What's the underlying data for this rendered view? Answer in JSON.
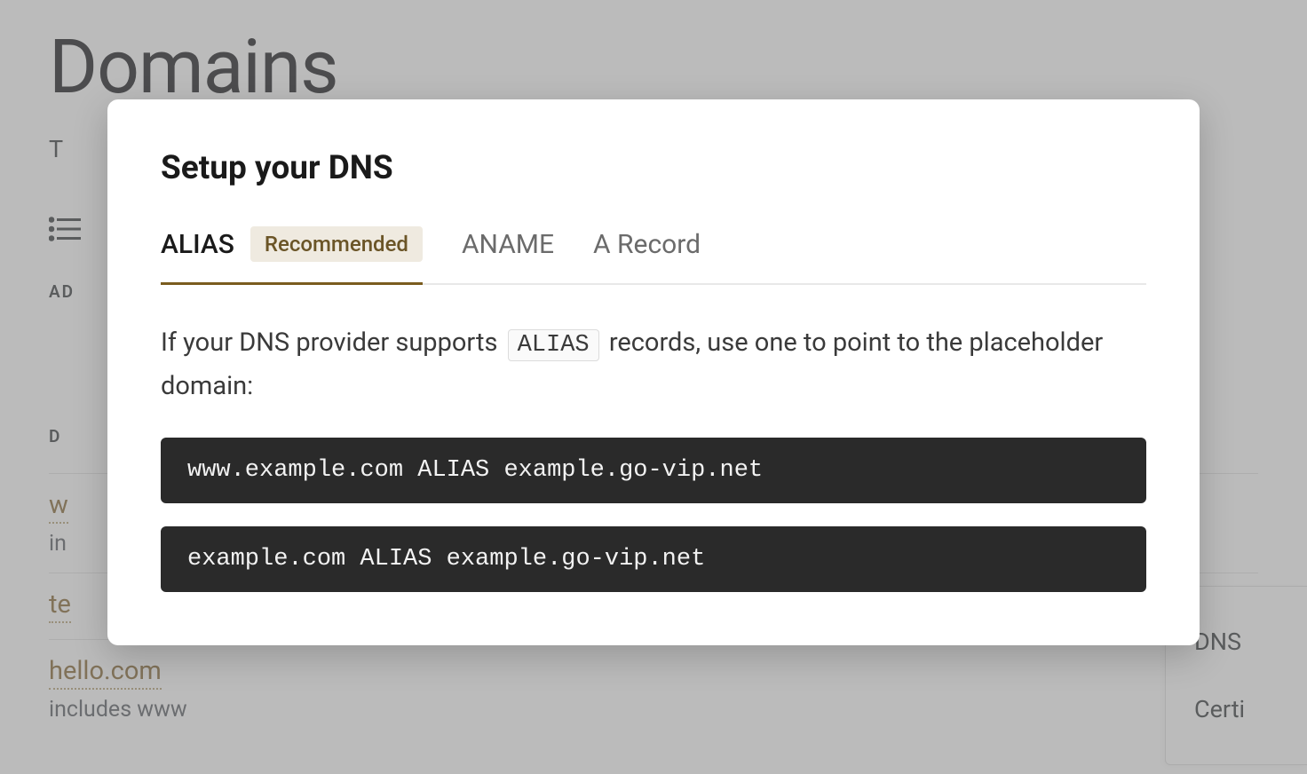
{
  "background": {
    "title": "Domains",
    "subtitle_prefix": "T",
    "section_label_add": "AD",
    "section_label_domain": "D",
    "domains": [
      {
        "name": "w",
        "sub": "in"
      },
      {
        "name": "te",
        "sub": ""
      },
      {
        "name": "hello.com",
        "sub": "includes www"
      }
    ],
    "right_panel": {
      "item1": "DNS",
      "item2": "Certi"
    }
  },
  "modal": {
    "title": "Setup your DNS",
    "tabs": [
      {
        "label": "ALIAS",
        "badge": "Recommended",
        "active": true
      },
      {
        "label": "ANAME",
        "active": false
      },
      {
        "label": "A Record",
        "active": false
      }
    ],
    "body": {
      "text_before": "If your DNS provider supports ",
      "inline_code": "ALIAS",
      "text_after": " records, use one to point to the placeholder domain:"
    },
    "code_blocks": [
      "www.example.com ALIAS example.go-vip.net",
      "example.com ALIAS example.go-vip.net"
    ]
  }
}
